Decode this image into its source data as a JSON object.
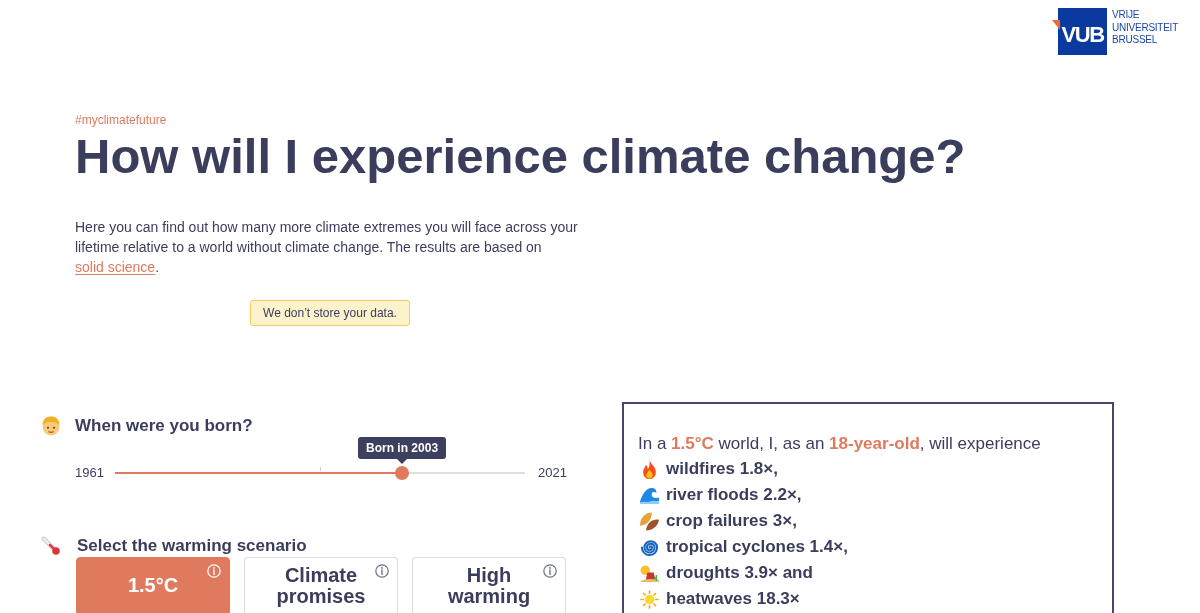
{
  "logo": {
    "mark": "VUB",
    "lines": [
      "VRIJE",
      "UNIVERSITEIT",
      "BRUSSEL"
    ]
  },
  "hashtag": "#myclimatefuture",
  "title": "How will I experience climate change?",
  "intro": {
    "text": "Here you can find out how many more climate extremes you will face across your lifetime relative to a world without climate change. The results are based on",
    "link": "solid science",
    "after": "."
  },
  "privacy_note": "We don’t store your data.",
  "birth_year": {
    "question": "When were you born?",
    "min": "1961",
    "max": "2021",
    "tooltip": "Born in 2003",
    "level": 0.7
  },
  "scenario": {
    "question": "Select the warming scenario",
    "options": [
      {
        "label": "1.5°C",
        "selected": true
      },
      {
        "label": "Climate promises",
        "selected": false
      },
      {
        "label": "High warming",
        "selected": false
      }
    ]
  },
  "result": {
    "summary": "In a **1.5°C** world, I, as an **18-year-old**, will experience",
    "items": [
      {
        "kind": "wildfire",
        "text": "wildfires 1.8×,"
      },
      {
        "kind": "river_flood",
        "text": "river floods 2.2×,"
      },
      {
        "kind": "crop_failure",
        "text": "crop failures 3×,"
      },
      {
        "kind": "tropical_cyclone",
        "text": "tropical cyclones 1.4×,"
      },
      {
        "kind": "drought",
        "text": "droughts 3.9× and"
      },
      {
        "kind": "heatwave",
        "text": "heatwaves 18.3×"
      }
    ]
  }
}
